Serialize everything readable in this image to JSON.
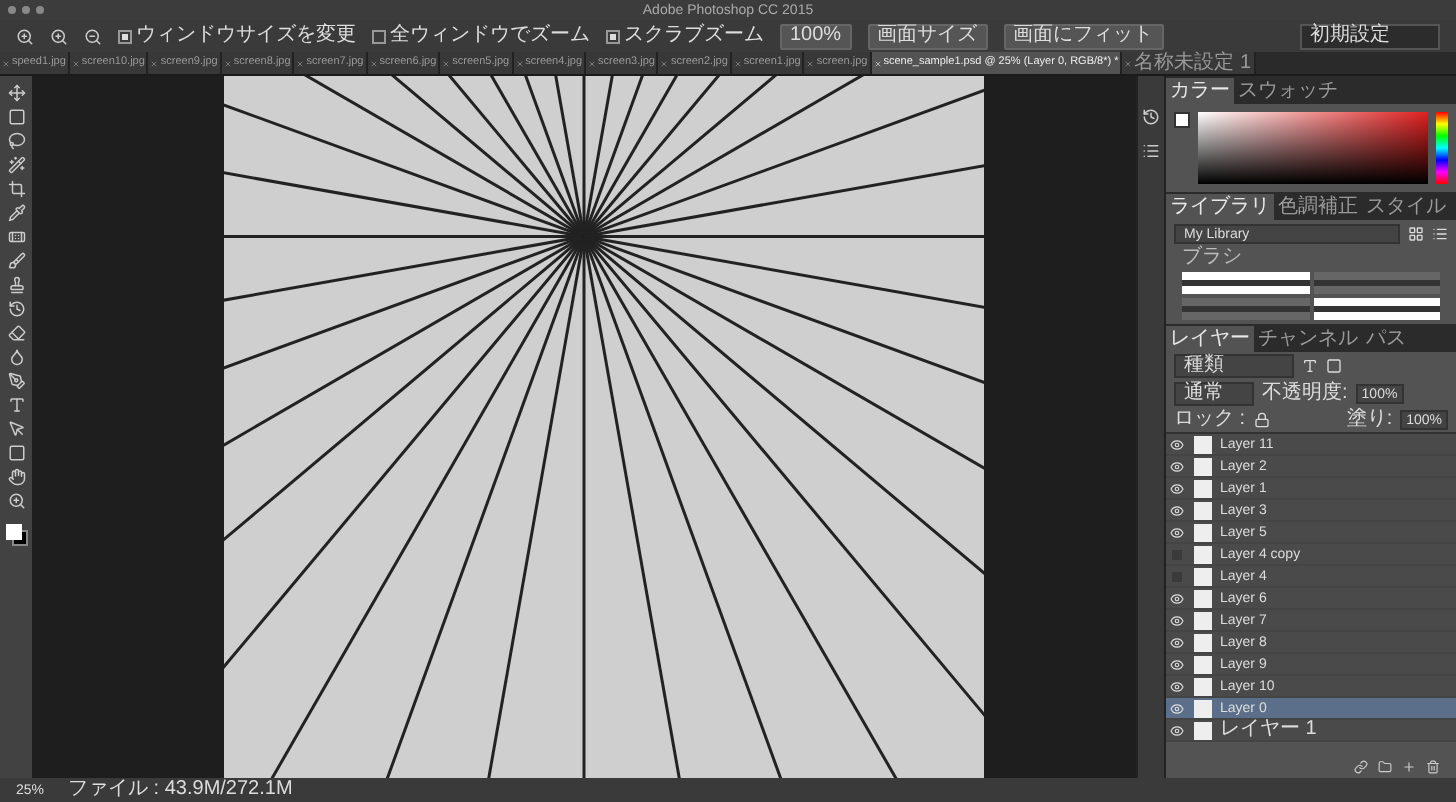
{
  "window": {
    "title": "Adobe Photoshop CC 2015"
  },
  "options_bar": {
    "checkboxes": [
      {
        "label": "ウィンドウサイズを変更",
        "checked": true
      },
      {
        "label": "全ウィンドウでズーム",
        "checked": false
      },
      {
        "label": "スクラブズーム",
        "checked": true
      }
    ],
    "buttons": [
      "100%",
      "画面サイズ",
      "画面にフィット"
    ],
    "workspace": "初期設定"
  },
  "document_tabs": [
    {
      "label": "speed1.jpg",
      "selected": false
    },
    {
      "label": "screen10.jpg",
      "selected": false
    },
    {
      "label": "screen9.jpg",
      "selected": false
    },
    {
      "label": "screen8.jpg",
      "selected": false
    },
    {
      "label": "screen7.jpg",
      "selected": false
    },
    {
      "label": "screen6.jpg",
      "selected": false
    },
    {
      "label": "screen5.jpg",
      "selected": false
    },
    {
      "label": "screen4.jpg",
      "selected": false
    },
    {
      "label": "screen3.jpg",
      "selected": false
    },
    {
      "label": "screen2.jpg",
      "selected": false
    },
    {
      "label": "screen1.jpg",
      "selected": false
    },
    {
      "label": "screen.jpg",
      "selected": false
    },
    {
      "label": "scene_sample1.psd @ 25% (Layer 0, RGB/8*) *",
      "selected": true
    },
    {
      "label": "名称未設定 1",
      "selected": false
    }
  ],
  "color_panel": {
    "tabs": [
      {
        "label": "カラー",
        "selected": true
      },
      {
        "label": "スウォッチ",
        "selected": false
      }
    ]
  },
  "library_panel": {
    "tabs": [
      {
        "label": "ライブラリ",
        "selected": true
      },
      {
        "label": "色調補正",
        "selected": false
      },
      {
        "label": "スタイル",
        "selected": false
      }
    ],
    "library": "My Library",
    "section": "ブラシ"
  },
  "layers_panel": {
    "tabs": [
      {
        "label": "レイヤー",
        "selected": true
      },
      {
        "label": "チャンネル",
        "selected": false
      },
      {
        "label": "パス",
        "selected": false
      }
    ],
    "kind": "種類",
    "blend_mode": "通常",
    "opacity_label": "不透明度:",
    "opacity": "100%",
    "lock_label": "ロック :",
    "fill_label": "塗り:",
    "fill": "100%",
    "layers": [
      {
        "name": "Layer 11",
        "visible": true,
        "selected": false
      },
      {
        "name": "Layer 2",
        "visible": true,
        "selected": false
      },
      {
        "name": "Layer 1",
        "visible": true,
        "selected": false
      },
      {
        "name": "Layer 3",
        "visible": true,
        "selected": false
      },
      {
        "name": "Layer 5",
        "visible": true,
        "selected": false
      },
      {
        "name": "Layer 4 copy",
        "visible": false,
        "selected": false
      },
      {
        "name": "Layer 4",
        "visible": false,
        "selected": false
      },
      {
        "name": "Layer 6",
        "visible": true,
        "selected": false
      },
      {
        "name": "Layer 7",
        "visible": true,
        "selected": false
      },
      {
        "name": "Layer 8",
        "visible": true,
        "selected": false
      },
      {
        "name": "Layer 9",
        "visible": true,
        "selected": false
      },
      {
        "name": "Layer 10",
        "visible": true,
        "selected": false
      },
      {
        "name": "Layer 0",
        "visible": true,
        "selected": true
      },
      {
        "name": "レイヤー 1",
        "visible": true,
        "selected": false
      }
    ]
  },
  "status_bar": {
    "zoom": "25%",
    "file_info": "ファイル : 43.9M/272.1M"
  }
}
